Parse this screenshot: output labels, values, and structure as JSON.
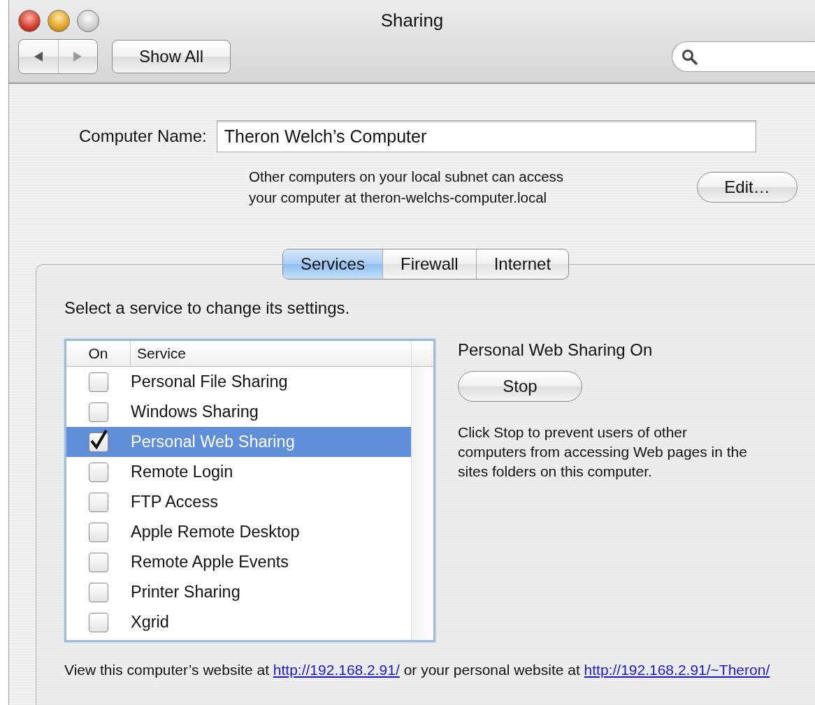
{
  "window": {
    "title": "Sharing"
  },
  "toolbar": {
    "show_all": "Show All"
  },
  "computer_name": {
    "label": "Computer Name:",
    "value": "Theron Welch’s Computer",
    "note": "Other computers on your local subnet can access\nyour computer at theron-welchs-computer.local",
    "edit_button": "Edit…"
  },
  "tabs": [
    {
      "label": "Services",
      "selected": true
    },
    {
      "label": "Firewall",
      "selected": false
    },
    {
      "label": "Internet",
      "selected": false
    }
  ],
  "instruction": "Select a service to change its settings.",
  "services": {
    "columns": [
      "On",
      "Service"
    ],
    "rows": [
      {
        "name": "Personal File Sharing",
        "on": false,
        "selected": false
      },
      {
        "name": "Windows Sharing",
        "on": false,
        "selected": false
      },
      {
        "name": "Personal Web Sharing",
        "on": true,
        "selected": true
      },
      {
        "name": "Remote Login",
        "on": false,
        "selected": false
      },
      {
        "name": "FTP Access",
        "on": false,
        "selected": false
      },
      {
        "name": "Apple Remote Desktop",
        "on": false,
        "selected": false
      },
      {
        "name": "Remote Apple Events",
        "on": false,
        "selected": false
      },
      {
        "name": "Printer Sharing",
        "on": false,
        "selected": false
      },
      {
        "name": "Xgrid",
        "on": false,
        "selected": false
      }
    ]
  },
  "detail": {
    "status": "Personal Web Sharing On",
    "button": "Stop",
    "description": "Click Stop to prevent users of other\ncomputers from accessing Web pages in the\nsites folders on this computer."
  },
  "footer": {
    "parts": [
      {
        "kind": "text",
        "text": "View this computer’s website at "
      },
      {
        "kind": "link",
        "text": "http://192.168.2.91/"
      },
      {
        "kind": "text",
        "text": " or your personal website at "
      },
      {
        "kind": "link",
        "text": "http://192.168.2.91/~Theron/"
      }
    ]
  }
}
